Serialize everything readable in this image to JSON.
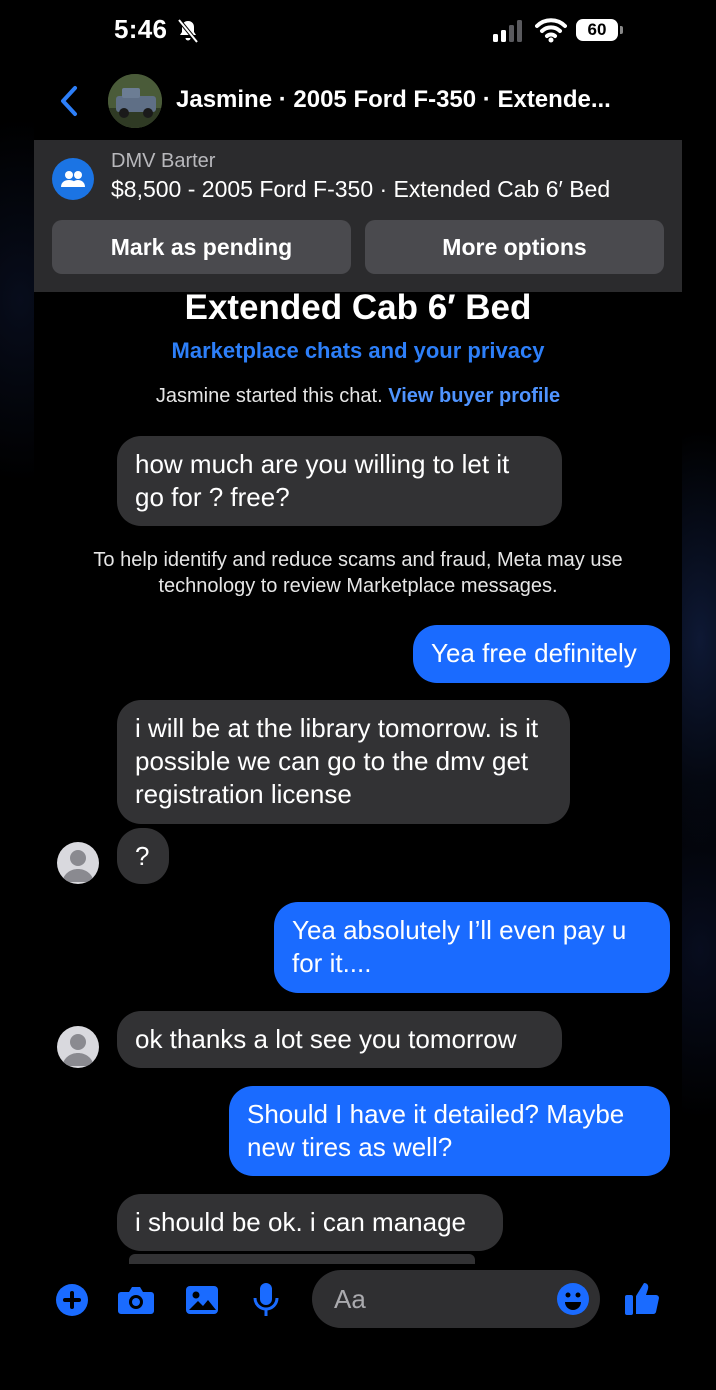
{
  "status_bar": {
    "time": "5:46",
    "battery": "60"
  },
  "header": {
    "title": "Jasmine · 2005 Ford F-350 · Extende..."
  },
  "listing": {
    "group": "DMV Barter",
    "title": "$8,500 - 2005 Ford F-350 · Extended Cab 6′ Bed",
    "buttons": {
      "pending": "Mark as pending",
      "options": "More options"
    }
  },
  "chat": {
    "heading": "Extended Cab 6′ Bed",
    "privacy_link": "Marketplace chats and your privacy",
    "started_text": "Jasmine started this chat.",
    "buyer_profile_link": "View buyer profile",
    "notice": "To help identify and reduce scams and fraud, Meta may use technology to review Marketplace messages.",
    "messages": [
      {
        "from": "buyer",
        "text": "how much are you willing to let it go for ? free?"
      },
      {
        "from": "me",
        "text": "Yea free definitely"
      },
      {
        "from": "buyer",
        "text": "i will be at the library tomorrow. is it possible  we can go to the dmv get registration license"
      },
      {
        "from": "buyer",
        "text": "?"
      },
      {
        "from": "me",
        "text": "Yea absolutely I’ll even pay u for it...."
      },
      {
        "from": "buyer",
        "text": "ok thanks a lot see you tomorrow"
      },
      {
        "from": "me",
        "text": "Should I have it detailed? Maybe new tires as well?"
      },
      {
        "from": "buyer",
        "text": "i should be ok. i can manage"
      }
    ]
  },
  "composer": {
    "placeholder": "Aa"
  },
  "colors": {
    "accent": "#1a6bff",
    "link": "#2d7ff9",
    "incoming_bubble": "#323234",
    "panel": "#2b2b2d"
  }
}
